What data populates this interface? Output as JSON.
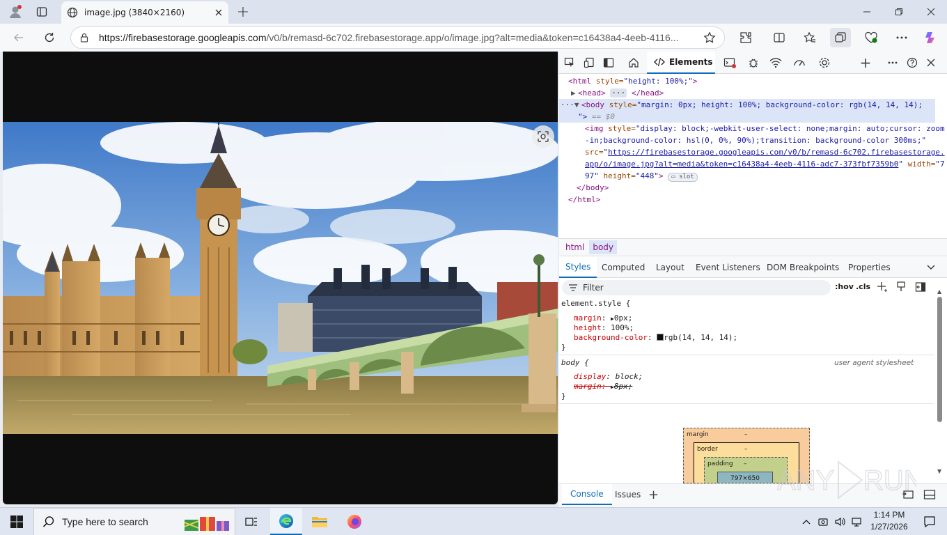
{
  "browser": {
    "tab_title": "image.jpg (3840×2160)",
    "new_tab_label": "+",
    "url_host": "https://firebasestorage.googleapis.com",
    "url_rest": "/v0/b/remasd-6c702.firebasestorage.app/o/image.jpg?alt=media&token=c16438a4-4eeb-4116..."
  },
  "devtools": {
    "toolbar": {
      "elements_tab": "Elements",
      "add_label": "+"
    },
    "dom": {
      "line1_tag": "<html",
      "line1_attr": " style=",
      "line1_val": "\"height: 100%;\"",
      "line1_end": ">",
      "line2_open": "<head>",
      "line2_dots": "···",
      "line2_close": "</head>",
      "line3_dots": "···",
      "line3_tag": "<body",
      "line3_attr": " style=",
      "line3_val": "\"margin: 0px; height: 100%; background-color: rgb(14, 14, 14);",
      "line4_val": "\">",
      "line4_ref": " == $0",
      "img_tag": "<img",
      "img_attr": " style=",
      "img_val1": "\"display: block;-webkit-user-select: none;margin: auto;cursor: zoom",
      "img_val2": "-in;background-color: hsl(0, 0%, 90%);transition: background-color 300ms;\"",
      "src_attr": "src=",
      "src_val1": "\"",
      "src_link1": "https://firebasestorage.googleapis.com/v0/b/remasd-6c702.firebasestorage.",
      "src_link2": "app/o/image.jpg?alt=media&token=c16438a4-4eeb-4116-adc7-373fbf7359b0",
      "src_end": "\"",
      "width_attr": " width=",
      "width_val1": "\"7",
      "width_val2": "97\"",
      "height_attr": " height=",
      "height_val": "\"448\"",
      "img_end": ">",
      "slot_badge": "slot",
      "body_close": "</body>",
      "html_close": "</html>"
    },
    "breadcrumbs": [
      "html",
      "body"
    ],
    "pane_tabs": [
      "Styles",
      "Computed",
      "Layout",
      "Event Listeners",
      "DOM Breakpoints",
      "Properties"
    ],
    "filter_placeholder": "Filter",
    "hov_label": ":hov",
    "cls_label": ".cls",
    "styles": {
      "rule1_selector": "element.style {",
      "rule1_props": [
        {
          "name": "margin",
          "value": "0px;"
        },
        {
          "name": "height",
          "value": "100%;"
        },
        {
          "name": "background-color",
          "value": "rgb(14, 14, 14);"
        }
      ],
      "close_brace": "}",
      "rule2_selector": "body {",
      "rule2_source": "user agent stylesheet",
      "rule2_display_name": "display",
      "rule2_display_value": "block;",
      "rule2_margin_name": "margin",
      "rule2_margin_value": "8px;"
    },
    "box_model": {
      "margin_label": "margin",
      "border_label": "border",
      "padding_label": "padding",
      "dash": "–",
      "content_size": "797×650"
    },
    "drawer": {
      "console_tab": "Console",
      "issues_tab": "Issues",
      "add_label": "+"
    }
  },
  "taskbar": {
    "search_placeholder": "Type here to search",
    "time": "1:14 PM",
    "date": "1/27/2026"
  },
  "watermark": "ANY RUN",
  "colors": {
    "accent": "#0f6cbd",
    "page_bg": "#0e0e0e",
    "tag": "#881280",
    "attr": "#994500",
    "attr_value": "#1a1aa6",
    "css_prop": "#c80000"
  }
}
